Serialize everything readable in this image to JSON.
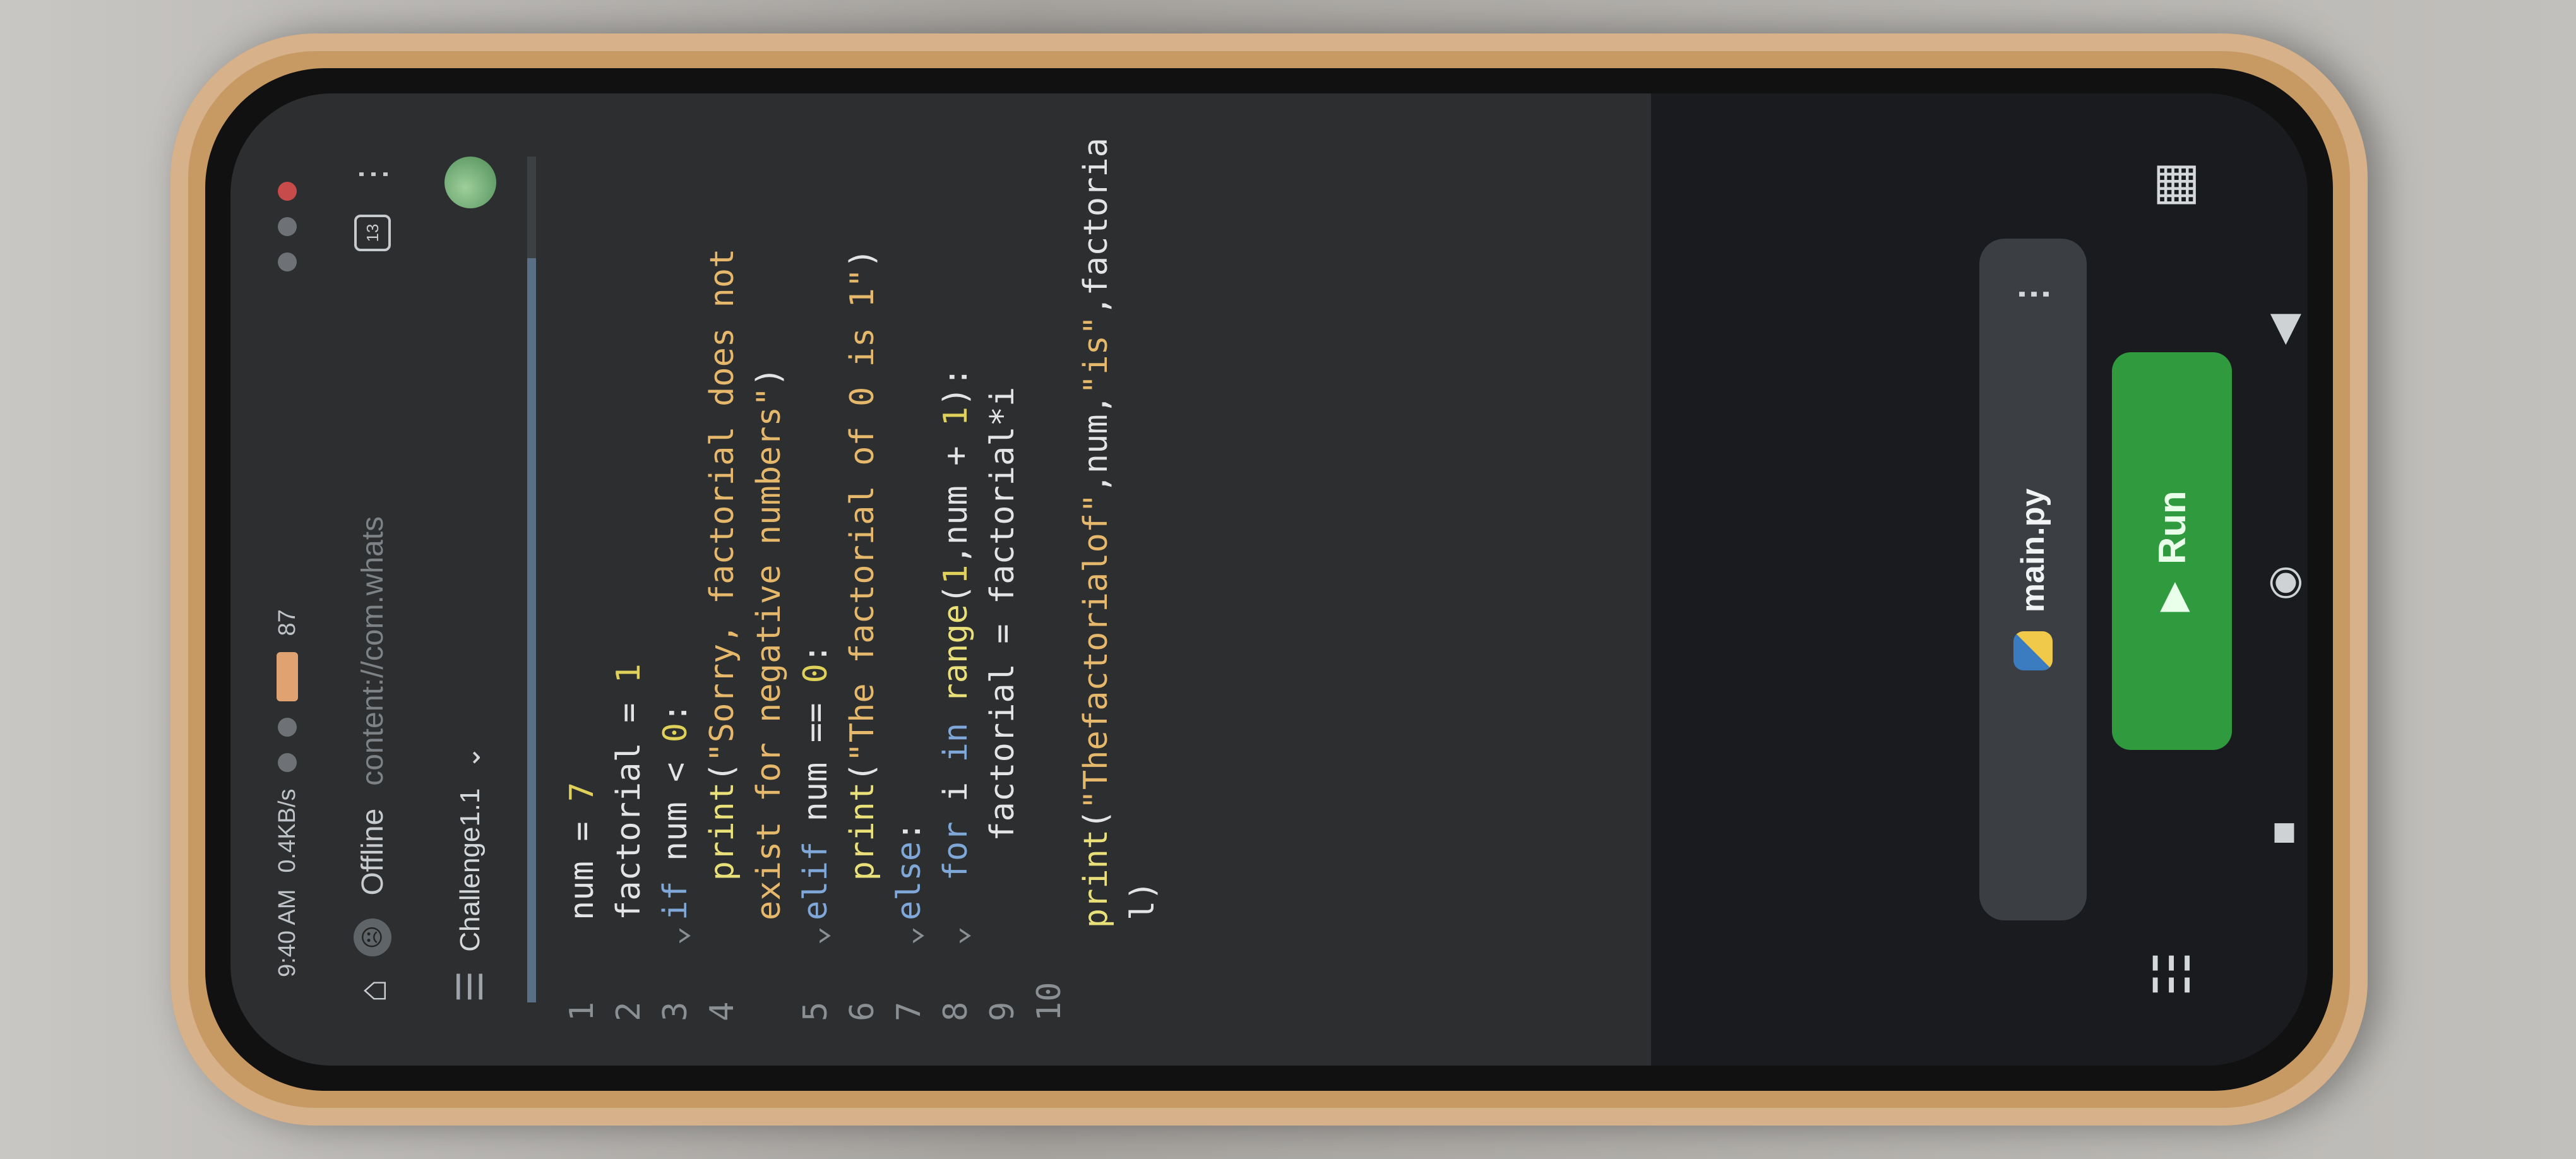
{
  "status_bar": {
    "time": "9:40 AM",
    "net_speed": "0.4KB/s",
    "battery": "87"
  },
  "browser": {
    "offline_label": "Offline",
    "url": "content://com.whats",
    "tabs_count": "13"
  },
  "app": {
    "project_title": "Challenge1.1",
    "title_caret": "⌄"
  },
  "editor": {
    "lines": [
      {
        "n": "1",
        "fold": "",
        "parts": [
          [
            "code",
            "num = "
          ],
          [
            "num",
            "7"
          ]
        ]
      },
      {
        "n": "2",
        "fold": "",
        "parts": [
          [
            "code",
            "factorial = "
          ],
          [
            "num",
            "1"
          ]
        ]
      },
      {
        "n": "3",
        "fold": "⌄",
        "parts": [
          [
            "kw",
            "if"
          ],
          [
            "code",
            " num < "
          ],
          [
            "num",
            "0"
          ],
          [
            "code",
            ":"
          ]
        ]
      },
      {
        "n": "4",
        "fold": "",
        "parts": [
          [
            "code",
            "  "
          ],
          [
            "fn",
            "print"
          ],
          [
            "code",
            "("
          ],
          [
            "str",
            "\"Sorry, factorial does not"
          ]
        ]
      },
      {
        "n": "",
        "fold": "",
        "parts": [
          [
            "str",
            "exist for negative numbers\""
          ],
          [
            "code",
            ")"
          ]
        ]
      },
      {
        "n": "5",
        "fold": "⌄",
        "parts": [
          [
            "kw",
            "elif"
          ],
          [
            "code",
            " num == "
          ],
          [
            "num",
            "0"
          ],
          [
            "code",
            ":"
          ]
        ]
      },
      {
        "n": "6",
        "fold": "",
        "parts": [
          [
            "code",
            "  "
          ],
          [
            "fn",
            "print"
          ],
          [
            "code",
            "("
          ],
          [
            "str",
            "\"The factorial of 0 is 1\""
          ],
          [
            "code",
            ")"
          ]
        ]
      },
      {
        "n": "7",
        "fold": "⌄",
        "parts": [
          [
            "kw",
            "else"
          ],
          [
            "code",
            ":"
          ]
        ]
      },
      {
        "n": "8",
        "fold": "⌄",
        "parts": [
          [
            "code",
            "  "
          ],
          [
            "kw",
            "for"
          ],
          [
            "code",
            " i "
          ],
          [
            "kw",
            "in"
          ],
          [
            "code",
            " "
          ],
          [
            "fn",
            "range"
          ],
          [
            "code",
            "("
          ],
          [
            "num",
            "1"
          ],
          [
            "code",
            ",num + "
          ],
          [
            "num",
            "1"
          ],
          [
            "code",
            "):"
          ]
        ]
      },
      {
        "n": "9",
        "fold": "",
        "parts": [
          [
            "code",
            "    factorial = factorial*i"
          ]
        ]
      },
      {
        "n": "10",
        "fold": "",
        "parts": [
          [
            "code",
            ""
          ]
        ]
      },
      {
        "n": "",
        "fold": "",
        "parts": [
          [
            "fn",
            "print"
          ],
          [
            "code",
            "("
          ],
          [
            "str",
            "\"Thefactorialof\""
          ],
          [
            "code",
            ",num,"
          ],
          [
            "str",
            "\"is\""
          ],
          [
            "code",
            ",factoria"
          ]
        ]
      },
      {
        "n": "",
        "fold": "",
        "parts": [
          [
            "code",
            "l)"
          ]
        ]
      }
    ]
  },
  "file_bar": {
    "filename": "main.py",
    "more": "⋮"
  },
  "run_button": {
    "label": "Run"
  }
}
